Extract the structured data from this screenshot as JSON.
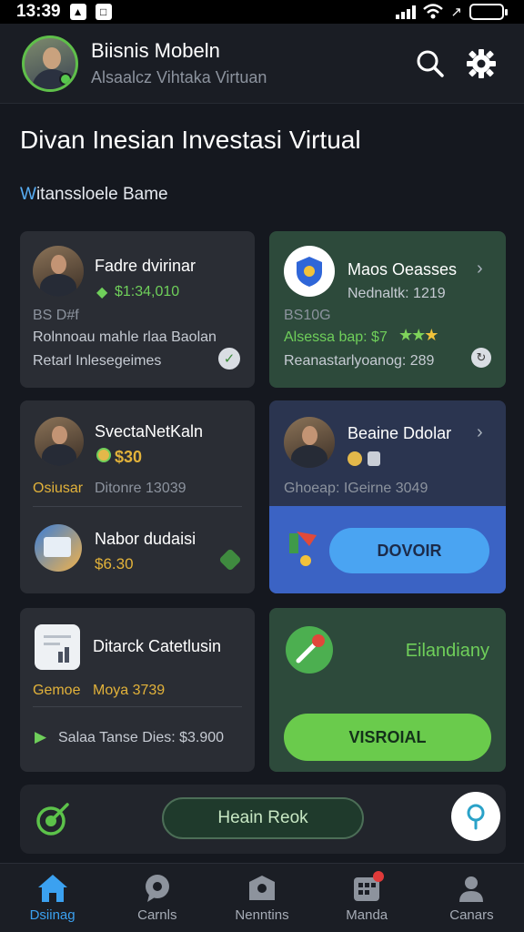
{
  "status_bar": {
    "time": "13:39"
  },
  "header": {
    "title": "Biisnis Mobeln",
    "subtitle": "Alsaalcz Vihtaka Virtuan"
  },
  "page": {
    "title": "Divan Inesian Investasi Virtual",
    "section_label": "Witanssloele Bame",
    "section_label_accent": "W"
  },
  "cards": {
    "c1": {
      "title": "Fadre dvirinar",
      "amount": "$1:34,010",
      "label": "BS D#f",
      "line1": "Rolnnoau mahle rlaa Baolan",
      "line2": "Retarl Inlesegeimes"
    },
    "c2": {
      "title": "Maos Oeasses",
      "line1": "Nednaltk: 1219",
      "code": "BS10G",
      "rating_text": "Alsessa bap: $7",
      "line2": "Reanastarlyoanog: 289"
    },
    "c3": {
      "title": "SvectaNetKaln",
      "amount": "$30",
      "label": "Osiusar",
      "value": "Ditonre 13039",
      "title2": "Nabor dudaisi",
      "amount2": "$6.30"
    },
    "c4": {
      "title": "Beaine Ddolar",
      "line1": "Ghoeap: IGeirne 3049",
      "button": "DOVOIR"
    },
    "c5": {
      "title": "Ditarck Catetlusin",
      "label": "Gemoe",
      "value": "Moya 3739",
      "line2": "Salaa Tanse Dies: $3.900"
    },
    "c6": {
      "title": "Eilandiany",
      "button": "VISROIAL"
    }
  },
  "bottom_panel": {
    "button": "Heain Reok"
  },
  "nav": [
    {
      "label": "Dsiinag",
      "icon": "home-icon",
      "active": true
    },
    {
      "label": "Carnls",
      "icon": "chat-icon",
      "active": false
    },
    {
      "label": "Nenntins",
      "icon": "wallet-icon",
      "active": false
    },
    {
      "label": "Manda",
      "icon": "grid-icon",
      "active": false
    },
    {
      "label": "Canars",
      "icon": "profile-icon",
      "active": false
    }
  ],
  "colors": {
    "accent_blue": "#3ba1f0",
    "accent_green": "#6fcf5a",
    "card_green": "#2d4a3b",
    "card_blue": "#2b3550",
    "bg": "#15181f"
  }
}
